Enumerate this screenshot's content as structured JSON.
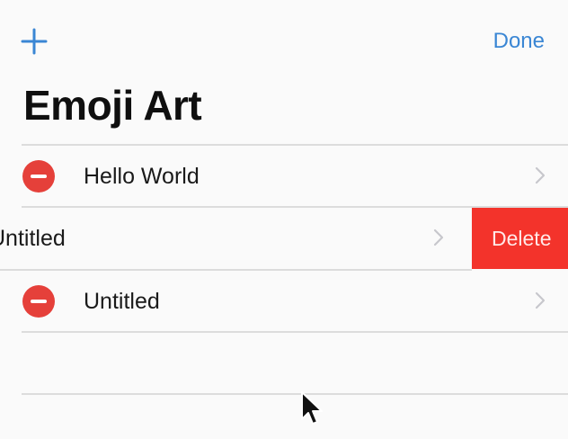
{
  "navbar": {
    "add_icon": "plus-icon",
    "done_label": "Done"
  },
  "title": "Emoji Art",
  "documents": [
    {
      "label": "Hello World",
      "state": "editing"
    },
    {
      "label": "Untitled",
      "state": "swiped",
      "action_label": "Delete"
    },
    {
      "label": "Untitled",
      "state": "editing"
    }
  ],
  "colors": {
    "accent": "#3a86d4",
    "delete_red": "#f3332b",
    "minus_red": "#e5403a"
  }
}
